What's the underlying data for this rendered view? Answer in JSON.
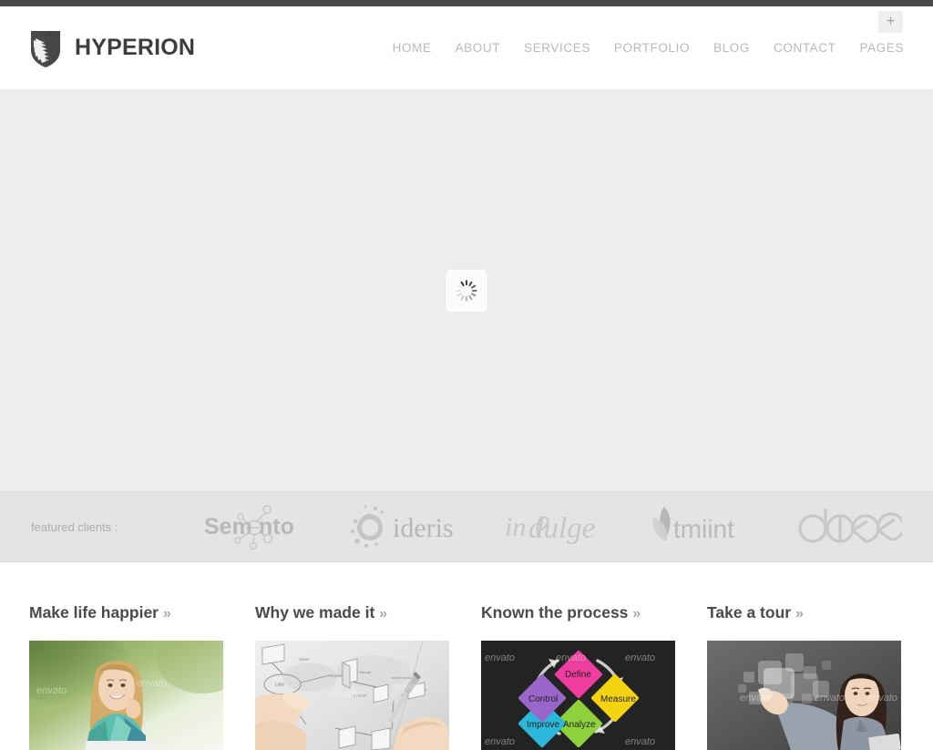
{
  "topbar": {
    "color": "#484848"
  },
  "header": {
    "brand": {
      "name": "HYPERION",
      "icon": "shield-feather-logo"
    },
    "nav": [
      {
        "label": "HOME"
      },
      {
        "label": "ABOUT"
      },
      {
        "label": "SERVICES"
      },
      {
        "label": "PORTFOLIO"
      },
      {
        "label": "BLOG"
      },
      {
        "label": "CONTACT"
      },
      {
        "label": "PAGES"
      }
    ],
    "plus_button": {
      "label": "+",
      "icon": "plus-icon"
    }
  },
  "hero": {
    "state": "loading",
    "background_color": "#ededed",
    "loader_icon": "spinner-icon"
  },
  "clients": {
    "label": "featured clients :",
    "background_color": "#e4e4e4",
    "logos": [
      {
        "name": "Semonto",
        "icon": "semonto-logo"
      },
      {
        "name": "ideris",
        "icon": "ideris-logo"
      },
      {
        "name": "indulge",
        "icon": "indulge-logo"
      },
      {
        "name": "tmiint",
        "icon": "tmiint-logo"
      },
      {
        "name": "abee",
        "icon": "abee-logo"
      }
    ]
  },
  "promos": [
    {
      "title": "Make life happier",
      "arrows": "»",
      "image": "girl-smiling-outdoors",
      "watermark": "envato"
    },
    {
      "title": "Why we made it",
      "arrows": "»",
      "image": "hand-drawing-network-diagram",
      "watermark": "envato"
    },
    {
      "title": "Known the process",
      "arrows": "»",
      "image": "chalkboard-process-cycle",
      "watermark": "envato",
      "sticky_notes": [
        "Define",
        "Measure",
        "Analyze",
        "Improve",
        "Control"
      ]
    },
    {
      "title": "Take a tour",
      "arrows": "»",
      "image": "woman-touching-virtual-screen",
      "watermark": "envato"
    }
  ]
}
